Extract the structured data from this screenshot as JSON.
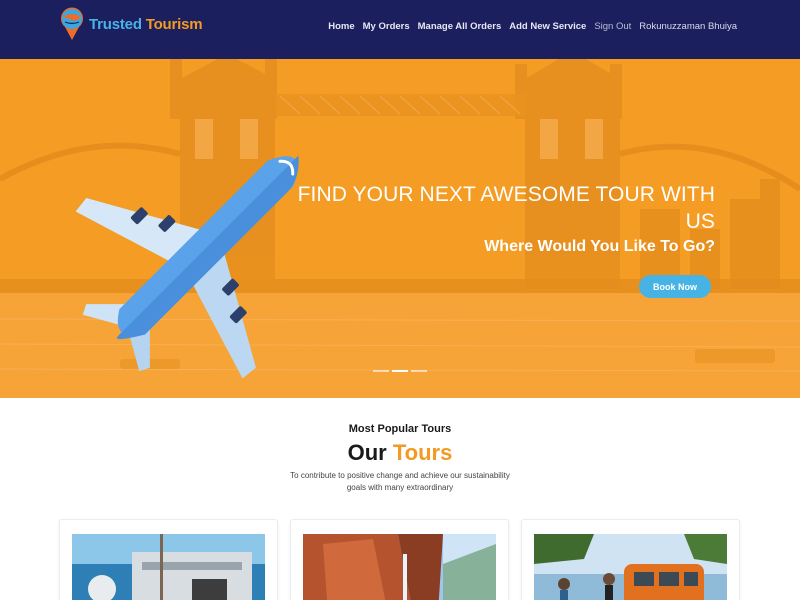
{
  "brand": {
    "name_part1": "Trusted",
    "name_part2": "Tourism",
    "icon": "map-pin-globe-icon"
  },
  "nav": {
    "items": [
      {
        "label": "Home"
      },
      {
        "label": "My Orders"
      },
      {
        "label": "Manage All Orders"
      },
      {
        "label": "Add New Service"
      },
      {
        "label": "Sign Out"
      },
      {
        "label": "Rokunuzzaman Bhuiya"
      }
    ]
  },
  "hero": {
    "title": "FIND YOUR NEXT AWESOME TOUR WITH US",
    "subtitle": "Where Would You Like To Go?",
    "button_label": "Book Now",
    "slide_count": 3,
    "active_slide": 2,
    "icons": [
      "airplane-icon"
    ]
  },
  "tours": {
    "eyebrow": "Most Popular Tours",
    "title_part1": "Our",
    "title_part2": "Tours",
    "description": "To contribute to positive change and achieve our sustainability goals with many extraordinary"
  },
  "colors": {
    "navbar": "#1c1f5d",
    "hero_overlay": "#f49c23",
    "accent_orange": "#f29a23",
    "accent_blue": "#47b3e4"
  }
}
